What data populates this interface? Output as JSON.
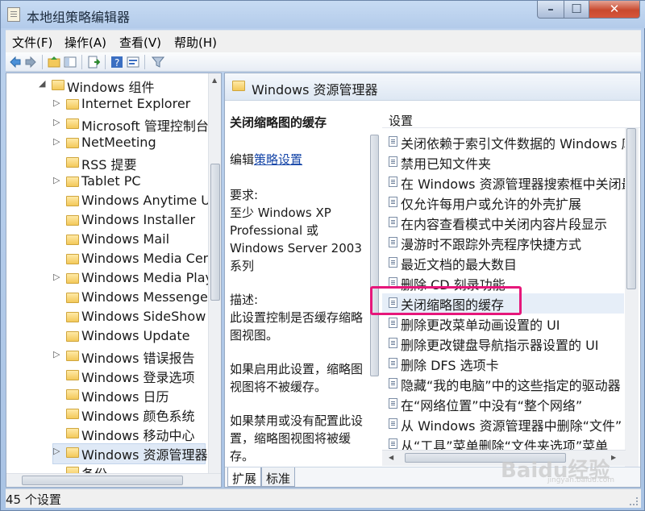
{
  "window": {
    "title": "本地组策略编辑器"
  },
  "menubar": [
    {
      "label": "文件(F)"
    },
    {
      "label": "操作(A)"
    },
    {
      "label": "查看(V)"
    },
    {
      "label": "帮助(H)"
    }
  ],
  "tree": {
    "parent": "Windows 组件",
    "items": [
      {
        "label": "Internet Explorer",
        "expandable": true
      },
      {
        "label": "Microsoft 管理控制台",
        "expandable": true
      },
      {
        "label": "NetMeeting",
        "expandable": true
      },
      {
        "label": "RSS 提要",
        "expandable": false
      },
      {
        "label": "Tablet PC",
        "expandable": true
      },
      {
        "label": "Windows Anytime Upgrade",
        "expandable": false
      },
      {
        "label": "Windows Installer",
        "expandable": false
      },
      {
        "label": "Windows Mail",
        "expandable": false
      },
      {
        "label": "Windows Media Center",
        "expandable": false
      },
      {
        "label": "Windows Media Player",
        "expandable": true
      },
      {
        "label": "Windows Messenger",
        "expandable": false
      },
      {
        "label": "Windows SideShow",
        "expandable": false
      },
      {
        "label": "Windows Update",
        "expandable": false
      },
      {
        "label": "Windows 错误报告",
        "expandable": true
      },
      {
        "label": "Windows 登录选项",
        "expandable": false
      },
      {
        "label": "Windows 日历",
        "expandable": false
      },
      {
        "label": "Windows 颜色系统",
        "expandable": false
      },
      {
        "label": "Windows 移动中心",
        "expandable": false
      },
      {
        "label": "Windows 资源管理器",
        "expandable": true,
        "selected": true
      },
      {
        "label": "备份",
        "expandable": false
      }
    ]
  },
  "right": {
    "header": "Windows 资源管理器",
    "desc": {
      "title": "关闭缩略图的缓存",
      "edit_prefix": "编辑",
      "edit_link": "策略设置",
      "req_label": "要求:",
      "req_lines": [
        "至少 Windows XP",
        "Professional 或",
        "Windows Server 2003",
        "系列"
      ],
      "desc_label": "描述:",
      "desc_lines": [
        "此设置控制是否缓存缩略",
        "图视图。"
      ],
      "enable_lines": [
        "如果启用此设置，缩略图",
        "视图将不被缓存。"
      ],
      "disable_lines": [
        "如果禁用或没有配置此设",
        "置，缩略图视图将被缓",
        "存。"
      ]
    },
    "column_header": "设置",
    "settings": [
      "关闭依赖于索引文件数据的 Windows 库",
      "禁用已知文件夹",
      "在 Windows 资源管理器搜索框中关闭最",
      "仅允许每用户或允许的外壳扩展",
      "在内容查看模式中关闭内容片段显示",
      "漫游时不跟踪外壳程序快捷方式",
      "最近文档的最大数目",
      "删除 CD 刻录功能",
      "关闭缩略图的缓存",
      "删除更改菜单动画设置的 UI",
      "删除更改键盘导航指示器设置的 UI",
      "删除 DFS 选项卡",
      "隐藏“我的电脑”中的这些指定的驱动器",
      "在“网络位置”中没有“整个网络”",
      "从 Windows 资源管理器中删除“文件”",
      "从“工具”菜单删除“文件夹选项”菜单"
    ],
    "selected_index": 8,
    "tabs": [
      "扩展",
      "标准"
    ]
  },
  "status": {
    "text": "45 个设置"
  },
  "watermark": {
    "text": "Baidu经验",
    "sub": "jingyan.baidu.com"
  },
  "colors": {
    "highlight": "#e6177a",
    "link": "#1646a8"
  }
}
